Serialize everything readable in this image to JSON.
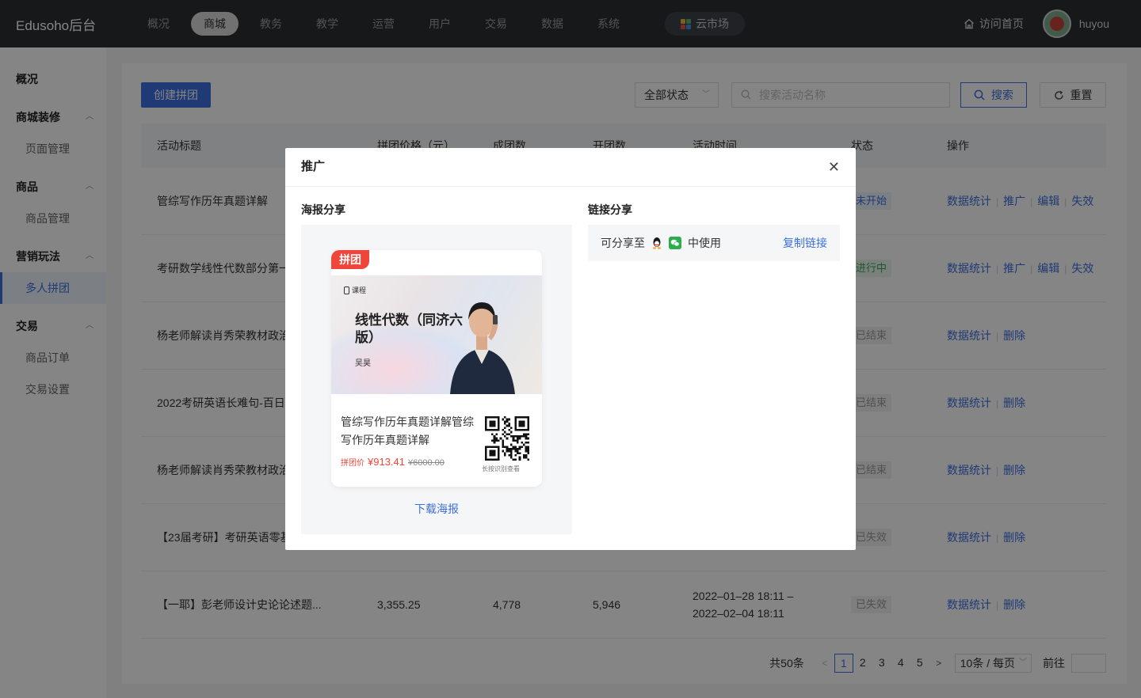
{
  "app": {
    "brand": "Edusoho后台"
  },
  "topnav": {
    "items": [
      {
        "label": "概况",
        "active": false
      },
      {
        "label": "商城",
        "active": true
      },
      {
        "label": "教务",
        "active": false
      },
      {
        "label": "教学",
        "active": false
      },
      {
        "label": "运营",
        "active": false
      },
      {
        "label": "用户",
        "active": false
      },
      {
        "label": "交易",
        "active": false
      },
      {
        "label": "数据",
        "active": false
      },
      {
        "label": "系统",
        "active": false
      }
    ],
    "market": "云市场",
    "home": "访问首页",
    "user": "huyou"
  },
  "sidebar": {
    "overview": "概况",
    "groups": [
      {
        "label": "商城装修",
        "items": [
          "页面管理"
        ]
      },
      {
        "label": "商品",
        "items": [
          "商品管理"
        ]
      },
      {
        "label": "营销玩法",
        "items": [
          "多人拼团"
        ]
      },
      {
        "label": "交易",
        "items": [
          "商品订单",
          "交易设置"
        ]
      }
    ],
    "active": "多人拼团"
  },
  "toolbar": {
    "create": "创建拼团",
    "status_select": "全部状态",
    "search_placeholder": "搜索活动名称",
    "search": "搜索",
    "reset": "重置"
  },
  "table": {
    "headers": [
      "活动标题",
      "拼团价格（元）",
      "成团数",
      "开团数",
      "活动时间",
      "状态",
      "操作"
    ],
    "rows": [
      {
        "title": "管综写作历年真题详解",
        "price": "",
        "groups": "",
        "opened": "",
        "time1": "",
        "time2": "",
        "status": "未开始",
        "status_type": "s-wait",
        "ops": [
          "数据统计",
          "推广",
          "编辑",
          "失效"
        ]
      },
      {
        "title": "考研数学线性代数部分第一",
        "price": "",
        "groups": "",
        "opened": "",
        "time1": "",
        "time2": "",
        "status": "进行中",
        "status_type": "s-on",
        "ops": [
          "数据统计",
          "推广",
          "编辑",
          "失效"
        ]
      },
      {
        "title": "杨老师解读肖秀荣教材政治",
        "price": "",
        "groups": "",
        "opened": "",
        "time1": "",
        "time2": "",
        "status": "已结束",
        "status_type": "s-end",
        "ops": [
          "数据统计",
          "删除"
        ]
      },
      {
        "title": "2022考研英语长难句-百日",
        "price": "",
        "groups": "",
        "opened": "",
        "time1": "",
        "time2": "",
        "status": "已结束",
        "status_type": "s-end",
        "ops": [
          "数据统计",
          "删除"
        ]
      },
      {
        "title": "杨老师解读肖秀荣教材政治",
        "price": "",
        "groups": "",
        "opened": "",
        "time1": "",
        "time2": "",
        "status": "已结束",
        "status_type": "s-end",
        "ops": [
          "数据统计",
          "删除"
        ]
      },
      {
        "title": "【23届考研】考研英语零基",
        "price": "",
        "groups": "",
        "opened": "",
        "time1": "",
        "time2": "",
        "status": "已失效",
        "status_type": "s-off",
        "ops": [
          "数据统计",
          "删除"
        ]
      },
      {
        "title": "【一耶】彭老师设计史论论述题...",
        "price": "3,355.25",
        "groups": "4,778",
        "opened": "5,946",
        "time1": "2022–01–28 18:11 –",
        "time2": "2022–02–04 18:11",
        "status": "已失效",
        "status_type": "s-off",
        "ops": [
          "数据统计",
          "删除"
        ]
      }
    ]
  },
  "pagination": {
    "total": "共50条",
    "pages": [
      "1",
      "2",
      "3",
      "4",
      "5"
    ],
    "current": "1",
    "page_size": "10条 / 每页",
    "goto": "前往"
  },
  "modal": {
    "title": "推广",
    "poster_section": "海报分享",
    "link_section": "链接分享",
    "poster": {
      "badge": "拼团",
      "logo": "课程",
      "course_title": "线性代数（同济六版）",
      "author": "吴昊",
      "name": "管综写作历年真题详解管综写作历年真题详解",
      "price_label": "拼团价",
      "price": "¥913.41",
      "original_price": "¥6000.00",
      "qr_caption": "长按识别查看"
    },
    "download": "下载海报",
    "share_prefix": "可分享至",
    "share_suffix": "中使用",
    "copy_link": "复制链接"
  },
  "colors": {
    "primary": "#3d6fe0",
    "danger": "#f0453a",
    "topbar": "#2b2e33"
  }
}
